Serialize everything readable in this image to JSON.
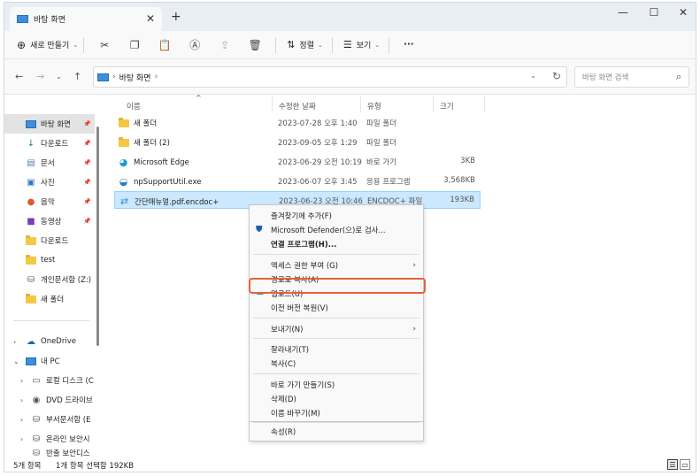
{
  "tab": {
    "title": "바탕 화면",
    "close": "✕",
    "new": "+"
  },
  "window_controls": {
    "minimize": "—",
    "maximize": "☐",
    "close": "✕"
  },
  "commandbar": {
    "new_label": "새로 만들기",
    "sort_label": "정렬",
    "view_label": "보기",
    "more": "···"
  },
  "address": {
    "location": "바탕 화면",
    "search_placeholder": "바탕 화면 검색"
  },
  "navpane": {
    "quick": [
      {
        "label": "바탕 화면",
        "pinned": true,
        "selected": true
      },
      {
        "label": "다운로드",
        "pinned": true
      },
      {
        "label": "문서",
        "pinned": true
      },
      {
        "label": "사진",
        "pinned": true
      },
      {
        "label": "음악",
        "pinned": true
      },
      {
        "label": "동영상",
        "pinned": true
      },
      {
        "label": "다운로드"
      },
      {
        "label": "test"
      },
      {
        "label": "개인문서함 (Z:)"
      },
      {
        "label": "새 폴더"
      }
    ],
    "tree": [
      {
        "label": "OneDrive"
      },
      {
        "label": "내 PC"
      },
      {
        "label": "로컬 디스크 (C"
      },
      {
        "label": "DVD 드라이브"
      },
      {
        "label": "부서문서함 (E"
      },
      {
        "label": "온라인 보안시"
      },
      {
        "label": "반출 보안디스"
      }
    ]
  },
  "columns": {
    "name": "이름",
    "modified": "수정한 날짜",
    "type": "유형",
    "size": "크기"
  },
  "files": [
    {
      "name": "새 폴더",
      "modified": "2023-07-28 오후 1:40",
      "type": "파일 폴더",
      "size": "",
      "icon": "folder-icon"
    },
    {
      "name": "새 폴더 (2)",
      "modified": "2023-09-05 오후 1:29",
      "type": "파일 폴더",
      "size": "",
      "icon": "folder-icon"
    },
    {
      "name": "Microsoft Edge",
      "modified": "2023-06-29 오전 10:19",
      "type": "바로 가기",
      "size": "3KB",
      "icon": "edge-icon"
    },
    {
      "name": "npSupportUtil.exe",
      "modified": "2023-06-07 오후 3:45",
      "type": "응용 프로그램",
      "size": "3,568KB",
      "icon": "exe-icon"
    },
    {
      "name": "간단매뉴얼.pdf.encdoc+",
      "modified": "2023-06-23 오전 10:46",
      "type": "ENCDOC+ 파일",
      "size": "193KB",
      "icon": "encdoc-icon"
    }
  ],
  "context_menu": {
    "favorites": "즐겨찾기에 추가(F)",
    "defender": "Microsoft Defender(으)로 검사...",
    "open_with": "연결 프로그램(H)...",
    "grant_access": "액세스 권한 부여 (G)",
    "copy_path": "경로로 복사(A)",
    "upload": "업로드(U)",
    "restore": "이전 버전 복원(V)",
    "send_to": "보내기(N)",
    "cut": "잘라내기(T)",
    "copy": "복사(C)",
    "shortcut": "바로 가기 만들기(S)",
    "delete": "삭제(D)",
    "rename": "이름 바꾸기(M)",
    "properties": "속성(R)"
  },
  "status": {
    "count": "5개 항목",
    "selection": "1개 항목 선택함 192KB"
  },
  "colors": {
    "accent": "#0067c0",
    "selection": "#cce8ff",
    "highlight_border": "#e8603c"
  }
}
